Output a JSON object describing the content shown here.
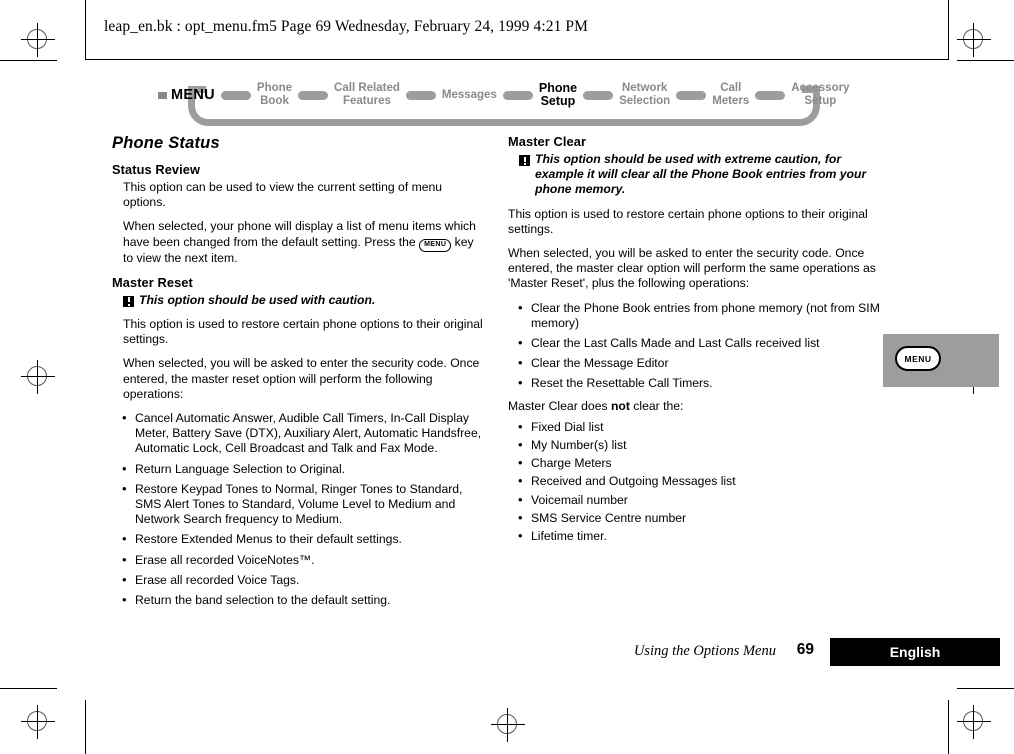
{
  "header": {
    "file_info": "leap_en.bk : opt_menu.fm5  Page 69  Wednesday, February 24, 1999  4:21 PM"
  },
  "nav": {
    "menu_label": "MENU",
    "items": [
      {
        "label": "Phone\nBook",
        "current": false
      },
      {
        "label": "Call Related\nFeatures",
        "current": false
      },
      {
        "label": "Messages",
        "current": false
      },
      {
        "label": "Phone\nSetup",
        "current": true
      },
      {
        "label": "Network\nSelection",
        "current": false
      },
      {
        "label": "Call\nMeters",
        "current": false
      },
      {
        "label": "Accessory\nSetup",
        "current": false
      }
    ]
  },
  "left_column": {
    "chapter_title": "Phone Status",
    "status_review": {
      "heading": "Status Review",
      "para1": "This option can be used to view the current setting of menu options.",
      "para2_before_key": "When selected, your phone will display a list of menu items which have been changed from the default setting. Press the ",
      "key_label": "MENU",
      "para2_after_key": " key to view the next item."
    },
    "master_reset": {
      "heading": "Master Reset",
      "warning": "This option should be used with caution.",
      "para1": "This option is used to restore certain phone options to their original settings.",
      "para2": "When selected, you will be asked to enter the security code. Once entered, the master reset option will perform the following operations:",
      "bullets": [
        "Cancel Automatic Answer, Audible Call Timers, In-Call Display Meter, Battery Save (DTX), Auxiliary Alert, Automatic Handsfree, Automatic Lock, Cell Broadcast and Talk and Fax Mode.",
        "Return Language Selection to Original.",
        "Restore Keypad Tones to Normal, Ringer Tones to Standard, SMS Alert Tones to Standard, Volume Level to Medium and Network Search frequency to Medium.",
        "Restore Extended Menus to their default settings.",
        "Erase all recorded VoiceNotes™.",
        "Erase all recorded Voice Tags.",
        "Return the band selection to the default setting."
      ]
    }
  },
  "right_column": {
    "master_clear": {
      "heading": "Master Clear",
      "warning": "This option should be used with extreme caution, for example it will clear all the Phone Book entries from your phone memory.",
      "para1": "This option is used to restore certain phone options to their original settings.",
      "para2": "When selected, you will be asked to enter the security code. Once entered, the master clear option will perform the same operations as 'Master Reset', plus the following operations:",
      "bullets": [
        "Clear the Phone Book entries from phone memory (not from SIM memory)",
        "Clear the Last Calls Made and Last Calls received list",
        "Clear the Message Editor",
        "Reset the Resettable Call Timers."
      ],
      "not_clear_lead_before": "Master Clear does ",
      "not_clear_lead_bold": "not",
      "not_clear_lead_after": " clear the:",
      "not_clear_bullets": [
        "Fixed Dial list",
        "My Number(s) list",
        "Charge Meters",
        "Received and Outgoing Messages list",
        "Voicemail number",
        "SMS Service Centre number",
        "Lifetime timer."
      ]
    }
  },
  "thumb_tab": {
    "key_label": "MENU"
  },
  "footer": {
    "running_head": "Using the Options Menu",
    "page_number": "69",
    "language": "English"
  },
  "colors": {
    "nav_gray": "#9d9d9d",
    "nav_text_gray": "#8a8a8a",
    "footer_bar": "#000000"
  }
}
